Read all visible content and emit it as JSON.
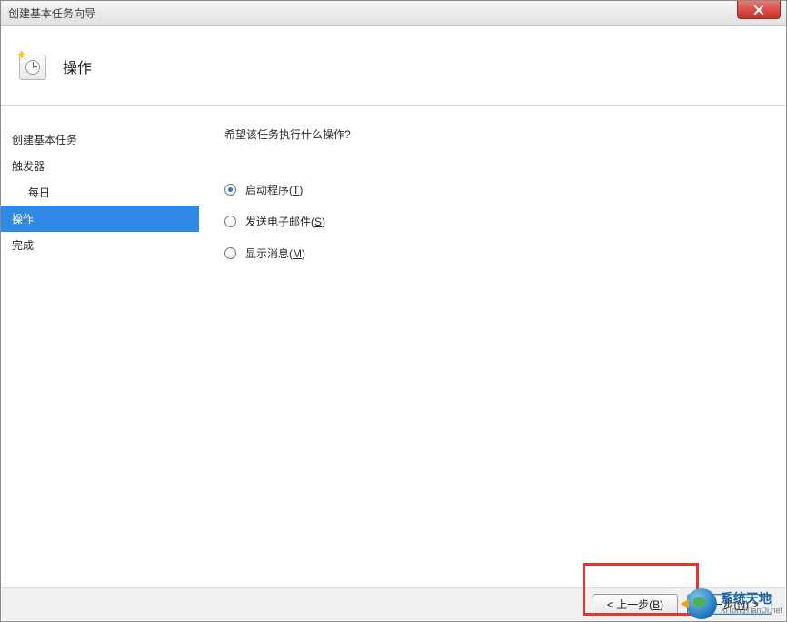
{
  "window": {
    "title": "创建基本任务向导"
  },
  "header": {
    "title": "操作"
  },
  "sidebar": {
    "items": [
      {
        "label": "创建基本任务",
        "selected": false,
        "sub": false
      },
      {
        "label": "触发器",
        "selected": false,
        "sub": false
      },
      {
        "label": "每日",
        "selected": false,
        "sub": true
      },
      {
        "label": "操作",
        "selected": true,
        "sub": false
      },
      {
        "label": "完成",
        "selected": false,
        "sub": false
      }
    ]
  },
  "content": {
    "prompt": "希望该任务执行什么操作?",
    "options": [
      {
        "label": "启动程序",
        "accel": "T",
        "checked": true
      },
      {
        "label": "发送电子邮件",
        "accel": "S",
        "checked": false
      },
      {
        "label": "显示消息",
        "accel": "M",
        "checked": false
      }
    ]
  },
  "footer": {
    "back": {
      "prefix": "< 上一步(",
      "accel": "B",
      "suffix": ")"
    },
    "next": {
      "prefix": "下一步(",
      "accel": "N",
      "suffix": ") >"
    }
  },
  "watermark": {
    "main": "系统天地",
    "sub": "XiTongTianDi.net"
  }
}
